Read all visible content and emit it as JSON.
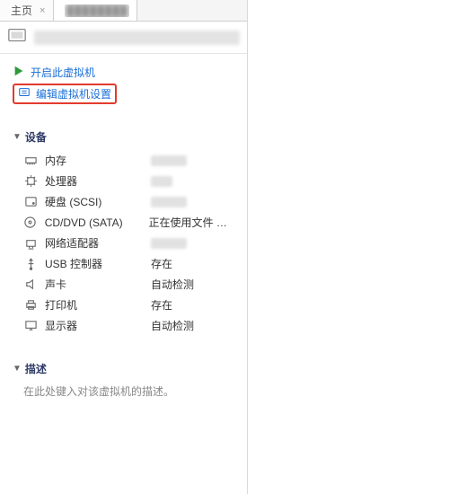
{
  "tabs": {
    "home_label": "主页",
    "second_label_obscured": "████████"
  },
  "title_obscured": "██████ ████ ████ ██",
  "actions": {
    "power_on": "开启此虚拟机",
    "edit_settings": "编辑虚拟机设置"
  },
  "sections": {
    "devices": "设备",
    "description": "描述"
  },
  "devices": [
    {
      "name": "内存",
      "value_obscured": true,
      "value": ""
    },
    {
      "name": "处理器",
      "value_obscured": true,
      "value": ""
    },
    {
      "name": "硬盘 (SCSI)",
      "value_obscured": true,
      "value": ""
    },
    {
      "name": "CD/DVD (SATA)",
      "value": "正在使用文件 D:..."
    },
    {
      "name": "网络适配器",
      "value_obscured": true,
      "value": ""
    },
    {
      "name": "USB 控制器",
      "value": "存在"
    },
    {
      "name": "声卡",
      "value": "自动检测"
    },
    {
      "name": "打印机",
      "value": "存在"
    },
    {
      "name": "显示器",
      "value": "自动检测"
    }
  ],
  "description_placeholder": "在此处键入对该虚拟机的描述。"
}
